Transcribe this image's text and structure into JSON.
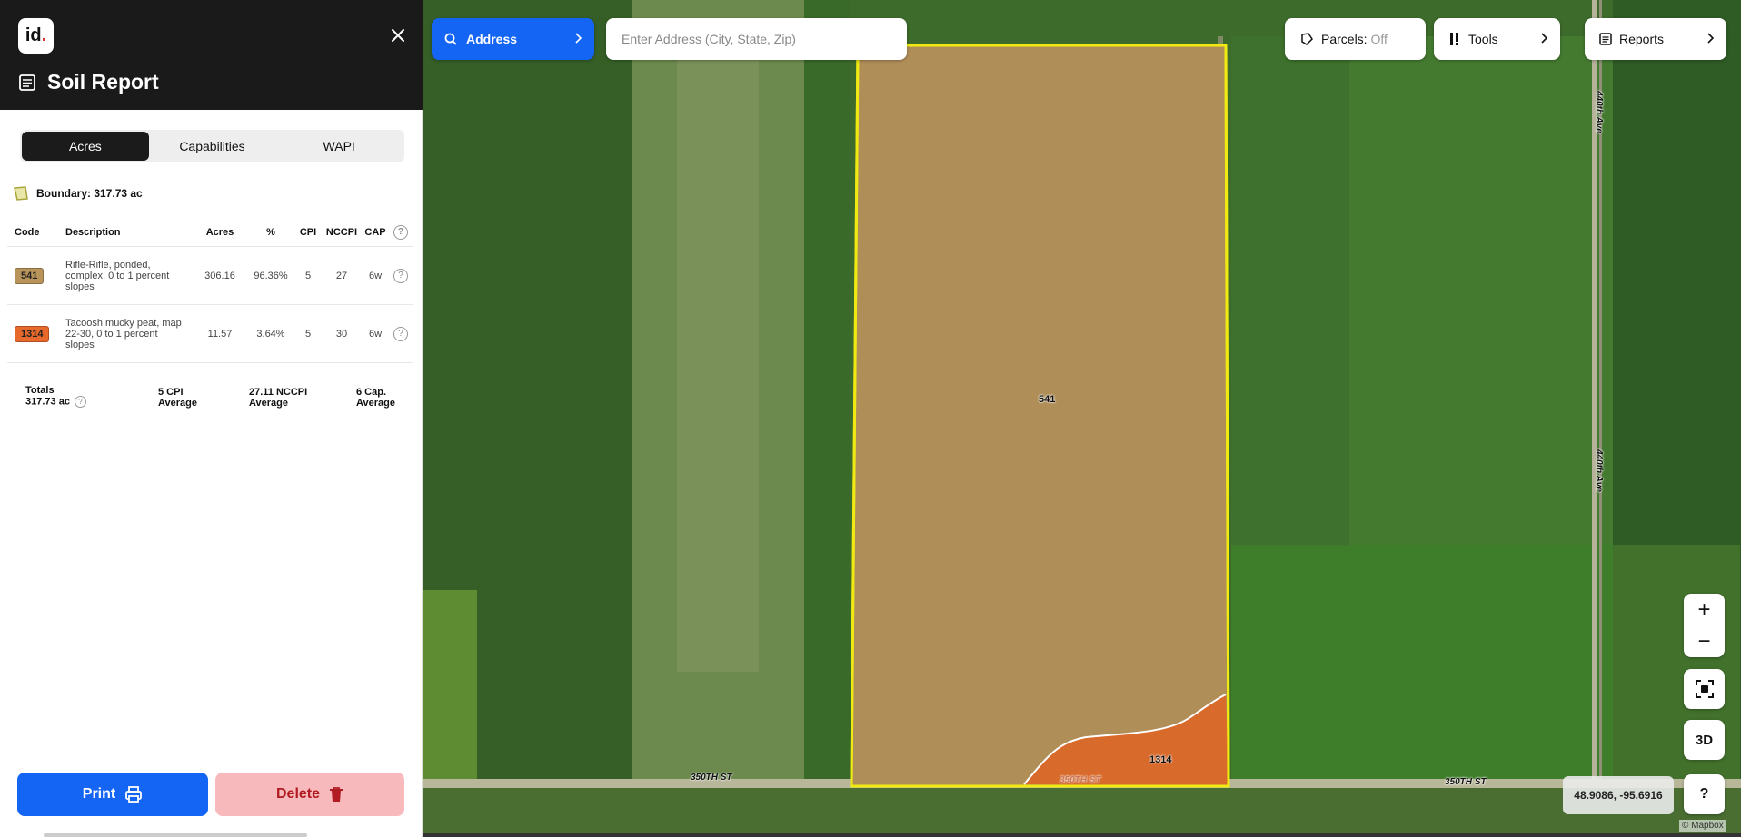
{
  "panel": {
    "logo": "id.",
    "title": "Soil Report",
    "tabs": [
      {
        "label": "Acres",
        "active": true
      },
      {
        "label": "Capabilities",
        "active": false
      },
      {
        "label": "WAPI",
        "active": false
      }
    ],
    "boundary": "Boundary: 317.73 ac",
    "table": {
      "headers": {
        "code": "Code",
        "description": "Description",
        "acres": "Acres",
        "pct": "%",
        "cpi": "CPI",
        "nccpi": "NCCPI",
        "cap": "CAP"
      },
      "rows": [
        {
          "code": "541",
          "color": "#b8935a",
          "description": "Rifle-Rifle, ponded, complex, 0 to 1 percent slopes",
          "acres": "306.16",
          "pct": "96.36%",
          "cpi": "5",
          "nccpi": "27",
          "cap": "6w"
        },
        {
          "code": "1314",
          "color": "#e8692c",
          "description": "Tacoosh mucky peat, map 22-30, 0 to 1 percent slopes",
          "acres": "11.57",
          "pct": "3.64%",
          "cpi": "5",
          "nccpi": "30",
          "cap": "6w"
        }
      ]
    },
    "totals": {
      "label": "Totals",
      "acres": "317.73 ac",
      "cpi_value": "5 CPI",
      "cpi_sub": "Average",
      "nccpi_value": "27.11 NCCPI",
      "nccpi_sub": "Average",
      "cap_value": "6 Cap.",
      "cap_sub": "Average"
    },
    "print_label": "Print",
    "delete_label": "Delete"
  },
  "map": {
    "address_label": "Address",
    "address_placeholder": "Enter Address (City, State, Zip)",
    "parcels_label": "Parcels:",
    "parcels_state": "Off",
    "tools_label": "Tools",
    "reports_label": "Reports",
    "zoom_in": "+",
    "zoom_out": "−",
    "btn_3d": "3D",
    "help": "?",
    "coordinates": "48.9086, -95.6916",
    "credit": "© Mapbox",
    "road_labels": [
      "350TH ST",
      "350TH ST",
      "350TH ST",
      "440th Ave",
      "440th Ave"
    ],
    "soil_labels": [
      "541",
      "1314"
    ]
  }
}
